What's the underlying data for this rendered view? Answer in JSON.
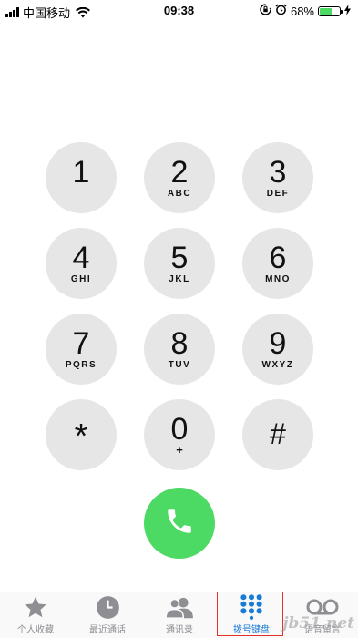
{
  "status_bar": {
    "carrier": "中国移动",
    "time": "09:38",
    "battery_percent": "68%",
    "battery_level": 0.68,
    "battery_color": "#4cd964"
  },
  "keypad": {
    "keys": [
      {
        "digit": "1",
        "letters": ""
      },
      {
        "digit": "2",
        "letters": "ABC"
      },
      {
        "digit": "3",
        "letters": "DEF"
      },
      {
        "digit": "4",
        "letters": "GHI"
      },
      {
        "digit": "5",
        "letters": "JKL"
      },
      {
        "digit": "6",
        "letters": "MNO"
      },
      {
        "digit": "7",
        "letters": "PQRS"
      },
      {
        "digit": "8",
        "letters": "TUV"
      },
      {
        "digit": "9",
        "letters": "WXYZ"
      },
      {
        "digit": "*",
        "letters": ""
      },
      {
        "digit": "0",
        "letters": "+"
      },
      {
        "digit": "#",
        "letters": ""
      }
    ],
    "call_button_icon": "phone-icon",
    "call_button_color": "#4cd964"
  },
  "tab_bar": {
    "tabs": [
      {
        "label": "个人收藏",
        "icon": "star-icon"
      },
      {
        "label": "最近通话",
        "icon": "clock-icon"
      },
      {
        "label": "通讯录",
        "icon": "contacts-icon"
      },
      {
        "label": "拨号键盘",
        "icon": "keypad-icon",
        "active": true
      },
      {
        "label": "语音留言",
        "icon": "voicemail-icon"
      }
    ],
    "active_color": "#1a7bd6",
    "highlight_color": "#e0322b"
  },
  "watermark": "jb51.net"
}
